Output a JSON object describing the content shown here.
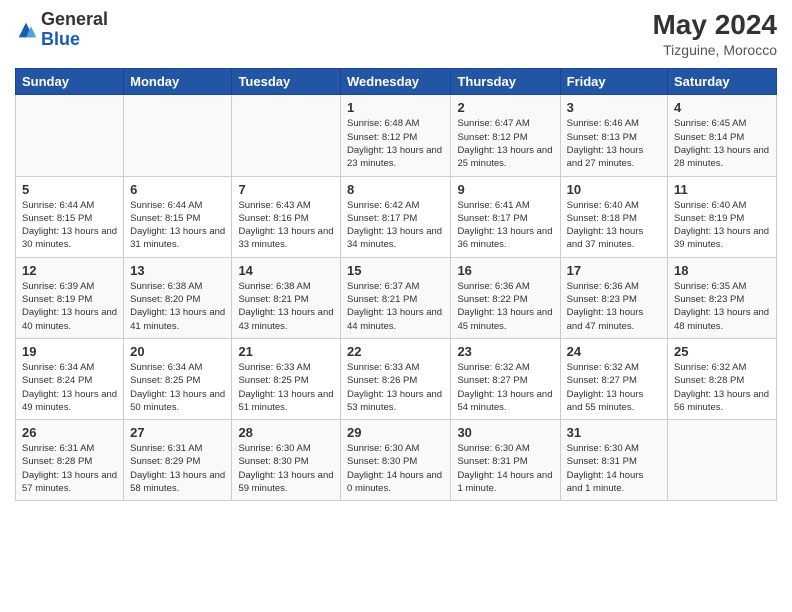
{
  "header": {
    "logo_general": "General",
    "logo_blue": "Blue",
    "title": "May 2024",
    "location": "Tizguine, Morocco"
  },
  "days_of_week": [
    "Sunday",
    "Monday",
    "Tuesday",
    "Wednesday",
    "Thursday",
    "Friday",
    "Saturday"
  ],
  "weeks": [
    [
      {
        "day": "",
        "info": ""
      },
      {
        "day": "",
        "info": ""
      },
      {
        "day": "",
        "info": ""
      },
      {
        "day": "1",
        "info": "Sunrise: 6:48 AM\nSunset: 8:12 PM\nDaylight: 13 hours and 23 minutes."
      },
      {
        "day": "2",
        "info": "Sunrise: 6:47 AM\nSunset: 8:12 PM\nDaylight: 13 hours and 25 minutes."
      },
      {
        "day": "3",
        "info": "Sunrise: 6:46 AM\nSunset: 8:13 PM\nDaylight: 13 hours and 27 minutes."
      },
      {
        "day": "4",
        "info": "Sunrise: 6:45 AM\nSunset: 8:14 PM\nDaylight: 13 hours and 28 minutes."
      }
    ],
    [
      {
        "day": "5",
        "info": "Sunrise: 6:44 AM\nSunset: 8:15 PM\nDaylight: 13 hours and 30 minutes."
      },
      {
        "day": "6",
        "info": "Sunrise: 6:44 AM\nSunset: 8:15 PM\nDaylight: 13 hours and 31 minutes."
      },
      {
        "day": "7",
        "info": "Sunrise: 6:43 AM\nSunset: 8:16 PM\nDaylight: 13 hours and 33 minutes."
      },
      {
        "day": "8",
        "info": "Sunrise: 6:42 AM\nSunset: 8:17 PM\nDaylight: 13 hours and 34 minutes."
      },
      {
        "day": "9",
        "info": "Sunrise: 6:41 AM\nSunset: 8:17 PM\nDaylight: 13 hours and 36 minutes."
      },
      {
        "day": "10",
        "info": "Sunrise: 6:40 AM\nSunset: 8:18 PM\nDaylight: 13 hours and 37 minutes."
      },
      {
        "day": "11",
        "info": "Sunrise: 6:40 AM\nSunset: 8:19 PM\nDaylight: 13 hours and 39 minutes."
      }
    ],
    [
      {
        "day": "12",
        "info": "Sunrise: 6:39 AM\nSunset: 8:19 PM\nDaylight: 13 hours and 40 minutes."
      },
      {
        "day": "13",
        "info": "Sunrise: 6:38 AM\nSunset: 8:20 PM\nDaylight: 13 hours and 41 minutes."
      },
      {
        "day": "14",
        "info": "Sunrise: 6:38 AM\nSunset: 8:21 PM\nDaylight: 13 hours and 43 minutes."
      },
      {
        "day": "15",
        "info": "Sunrise: 6:37 AM\nSunset: 8:21 PM\nDaylight: 13 hours and 44 minutes."
      },
      {
        "day": "16",
        "info": "Sunrise: 6:36 AM\nSunset: 8:22 PM\nDaylight: 13 hours and 45 minutes."
      },
      {
        "day": "17",
        "info": "Sunrise: 6:36 AM\nSunset: 8:23 PM\nDaylight: 13 hours and 47 minutes."
      },
      {
        "day": "18",
        "info": "Sunrise: 6:35 AM\nSunset: 8:23 PM\nDaylight: 13 hours and 48 minutes."
      }
    ],
    [
      {
        "day": "19",
        "info": "Sunrise: 6:34 AM\nSunset: 8:24 PM\nDaylight: 13 hours and 49 minutes."
      },
      {
        "day": "20",
        "info": "Sunrise: 6:34 AM\nSunset: 8:25 PM\nDaylight: 13 hours and 50 minutes."
      },
      {
        "day": "21",
        "info": "Sunrise: 6:33 AM\nSunset: 8:25 PM\nDaylight: 13 hours and 51 minutes."
      },
      {
        "day": "22",
        "info": "Sunrise: 6:33 AM\nSunset: 8:26 PM\nDaylight: 13 hours and 53 minutes."
      },
      {
        "day": "23",
        "info": "Sunrise: 6:32 AM\nSunset: 8:27 PM\nDaylight: 13 hours and 54 minutes."
      },
      {
        "day": "24",
        "info": "Sunrise: 6:32 AM\nSunset: 8:27 PM\nDaylight: 13 hours and 55 minutes."
      },
      {
        "day": "25",
        "info": "Sunrise: 6:32 AM\nSunset: 8:28 PM\nDaylight: 13 hours and 56 minutes."
      }
    ],
    [
      {
        "day": "26",
        "info": "Sunrise: 6:31 AM\nSunset: 8:28 PM\nDaylight: 13 hours and 57 minutes."
      },
      {
        "day": "27",
        "info": "Sunrise: 6:31 AM\nSunset: 8:29 PM\nDaylight: 13 hours and 58 minutes."
      },
      {
        "day": "28",
        "info": "Sunrise: 6:30 AM\nSunset: 8:30 PM\nDaylight: 13 hours and 59 minutes."
      },
      {
        "day": "29",
        "info": "Sunrise: 6:30 AM\nSunset: 8:30 PM\nDaylight: 14 hours and 0 minutes."
      },
      {
        "day": "30",
        "info": "Sunrise: 6:30 AM\nSunset: 8:31 PM\nDaylight: 14 hours and 1 minute."
      },
      {
        "day": "31",
        "info": "Sunrise: 6:30 AM\nSunset: 8:31 PM\nDaylight: 14 hours and 1 minute."
      },
      {
        "day": "",
        "info": ""
      }
    ]
  ]
}
